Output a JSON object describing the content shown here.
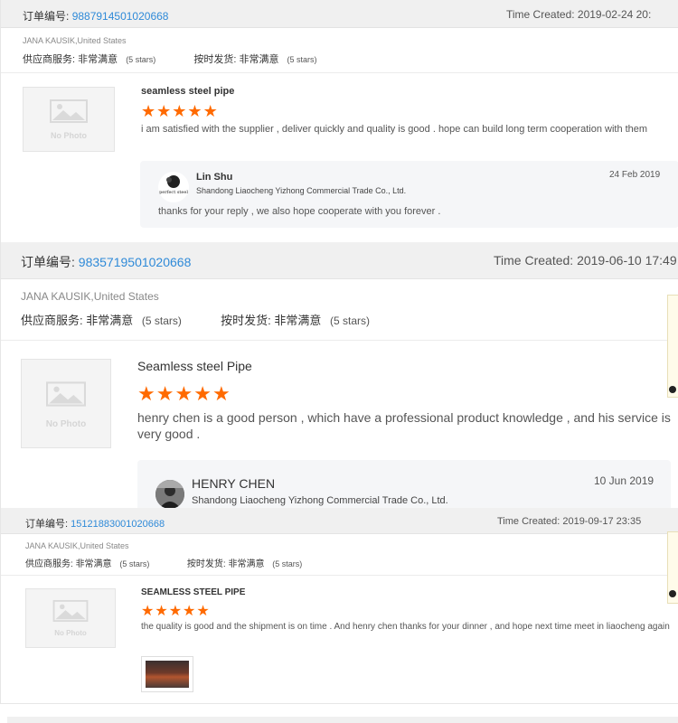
{
  "order_label": "订单编号:",
  "orders": [
    {
      "order_number": "9887914501020668",
      "time_created": "Time Created: 2019-02-24 20:",
      "buyer": "JANA KAUSIK,United States",
      "supplier_service_label": "供应商服务:",
      "supplier_service_value": "非常满意",
      "supplier_service_stars": "(5 stars)",
      "on_time_label": "按时发货:",
      "on_time_value": "非常满意",
      "on_time_stars": "(5 stars)",
      "no_photo_label": "No Photo",
      "product_title": "seamless steel pipe",
      "rating": 5,
      "review": "i am satisfied with the supplier , deliver quickly and quality is good .  hope can build long term cooperation with them",
      "reply": {
        "name": "Lin Shu",
        "company": "Shandong Liaocheng Yizhong Commercial Trade Co., Ltd.",
        "date": "24 Feb 2019",
        "text": "thanks for your reply , we also hope cooperate with you  forever .",
        "logo_text": "perfect steel"
      }
    },
    {
      "order_number": "9835719501020668",
      "time_created": "Time Created: 2019-06-10 17:49",
      "buyer": "JANA KAUSIK,United States",
      "supplier_service_label": "供应商服务:",
      "supplier_service_value": "非常满意",
      "supplier_service_stars": "(5 stars)",
      "on_time_label": "按时发货:",
      "on_time_value": "非常满意",
      "on_time_stars": "(5 stars)",
      "no_photo_label": "No Photo",
      "product_title": "Seamless steel Pipe",
      "rating": 5,
      "review": "henry chen is a good person , which have a professional product knowledge , and his service is very good .",
      "reply": {
        "name": "HENRY CHEN",
        "company": "Shandong Liaocheng Yizhong Commercial Trade Co., Ltd.",
        "date": "10 Jun 2019"
      }
    },
    {
      "order_number": "15121883001020668",
      "time_created": "Time Created: 2019-09-17 23:35",
      "buyer": "JANA KAUSIK,United States",
      "supplier_service_label": "供应商服务:",
      "supplier_service_value": "非常满意",
      "supplier_service_stars": "(5 stars)",
      "on_time_label": "按时发货:",
      "on_time_value": "非常满意",
      "on_time_stars": "(5 stars)",
      "no_photo_label": "No Photo",
      "product_title": "SEAMLESS STEEL PIPE",
      "rating": 5,
      "review": "the quality is good and the shipment is on time  . And henry chen thanks for your dinner , and hope next time meet in liaocheng again"
    }
  ],
  "colors": {
    "order_number": "#2f8ad8",
    "star": "#ff6a00",
    "header_bg": "#f0f0f0",
    "reply_bg": "#f5f6f8"
  },
  "icons": {
    "star": "star-icon",
    "no_photo": "image-placeholder-icon",
    "avatar": "avatar-icon"
  }
}
